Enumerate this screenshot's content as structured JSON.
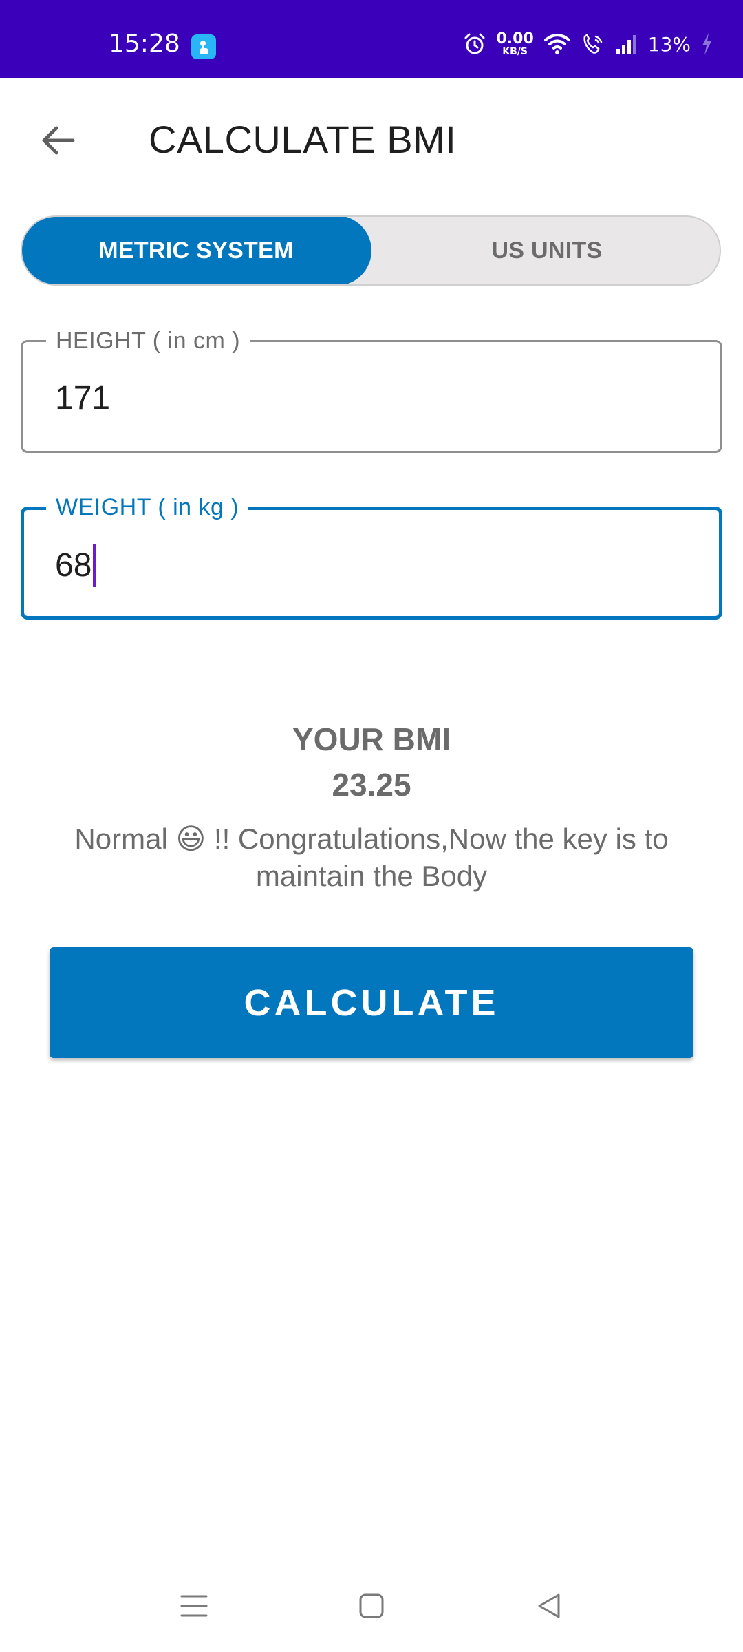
{
  "status_bar": {
    "time": "15:28",
    "net_speed_value": "0.00",
    "net_speed_unit": "KB/S",
    "battery_percent": "13%",
    "background_color": "#3b00b9"
  },
  "app_bar": {
    "title": "CALCULATE BMI",
    "back_icon": "arrow-left-icon"
  },
  "unit_toggle": {
    "options": [
      {
        "label": "METRIC SYSTEM",
        "selected": true
      },
      {
        "label": "US UNITS",
        "selected": false
      }
    ],
    "accent_color": "#0277bd"
  },
  "form": {
    "height": {
      "label": "HEIGHT ( in cm )",
      "value": "171"
    },
    "weight": {
      "label": "WEIGHT ( in kg )",
      "value": "68",
      "focused": true
    }
  },
  "result": {
    "title": "YOUR BMI",
    "value": "23.25",
    "message": "Normal 😃 !! Congratulations,Now the key is to maintain the Body"
  },
  "calculate_button": {
    "label": "CALCULATE"
  },
  "nav_bar": {
    "icons": [
      "menu-icon",
      "home-square-icon",
      "back-triangle-icon"
    ]
  }
}
